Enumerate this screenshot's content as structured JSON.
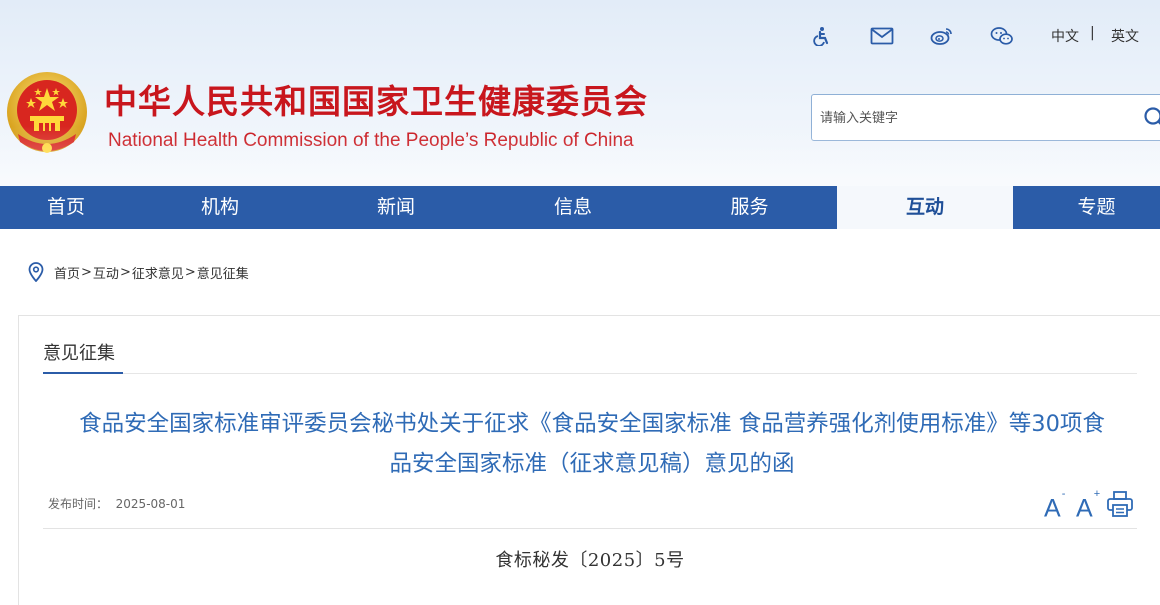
{
  "header": {
    "title_cn": "中华人民共和国国家卫生健康委员会",
    "title_en": "National Health Commission of the People’s  Republic of China",
    "top_icons": [
      "accessibility-icon",
      "mail-icon",
      "weibo-icon",
      "wechat-icon"
    ],
    "lang": {
      "cn": "中文",
      "sep": "|",
      "en": "英文"
    },
    "search": {
      "placeholder": "请输入关键字"
    }
  },
  "nav": {
    "items": [
      {
        "label": "首页"
      },
      {
        "label": "机构"
      },
      {
        "label": "新闻"
      },
      {
        "label": "信息"
      },
      {
        "label": "服务"
      },
      {
        "label": "互动",
        "active": true
      },
      {
        "label": "专题"
      }
    ]
  },
  "breadcrumb": {
    "items": [
      "首页",
      "互动",
      "征求意见",
      "意见征集"
    ],
    "sep": ">"
  },
  "section": {
    "title": "意见征集"
  },
  "article": {
    "title_line1": "食品安全国家标准审评委员会秘书处关于征求《食品安全国家标准 食品营养强化剂使用标准》等30项食",
    "title_line2": "品安全国家标准（征求意见稿）意见的函",
    "date_label": "发布时间：",
    "date_value": "2025-08-01",
    "doc_number": "食标秘发〔2025〕5号"
  },
  "tools": {
    "font_decrease": "A",
    "font_decrease_sup": "-",
    "font_increase": "A",
    "font_increase_sup": "+"
  },
  "colors": {
    "brand_red": "#c8161d",
    "nav_blue": "#2b5ca8",
    "title_blue": "#2f6bb6"
  }
}
